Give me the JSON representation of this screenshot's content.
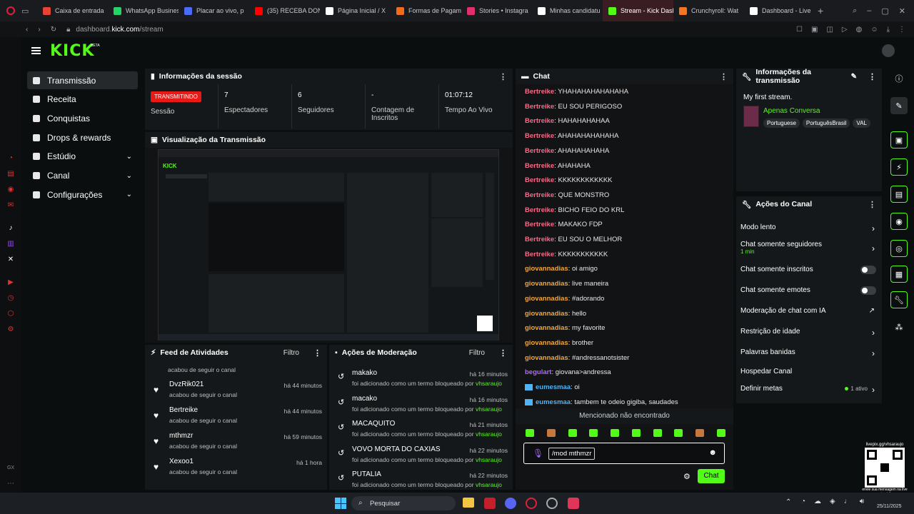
{
  "browser": {
    "tabs": [
      {
        "title": "Caixa de entrada",
        "color": "#ea4335"
      },
      {
        "title": "WhatsApp Business",
        "color": "#25d366"
      },
      {
        "title": "Placar ao vivo, p",
        "color": "#4a6cf7"
      },
      {
        "title": "(35) RECEBA DON",
        "color": "#ff0000"
      },
      {
        "title": "Página Inicial / X",
        "color": "#ffffff"
      },
      {
        "title": "Formas de Pagam",
        "color": "#f26b1d"
      },
      {
        "title": "Stories • Instagra",
        "color": "#e1306c"
      },
      {
        "title": "Minhas candidatu",
        "color": "#ffffff"
      },
      {
        "title": "Stream - Kick Dashb",
        "color": "#53fc18"
      },
      {
        "title": "Crunchyroll: Wat",
        "color": "#f47521"
      },
      {
        "title": "Dashboard - Live",
        "color": "#ffffff"
      }
    ],
    "url_prefix": "dashboard.",
    "url_host": "kick.com",
    "url_path": "/stream"
  },
  "brand": {
    "logo": "KICK",
    "beta": "BETA",
    "color": "#53fc18"
  },
  "nav": [
    {
      "label": "Transmissão",
      "active": true,
      "chevron": false
    },
    {
      "label": "Receita",
      "active": false,
      "chevron": false
    },
    {
      "label": "Conquistas",
      "active": false,
      "chevron": false
    },
    {
      "label": "Drops & rewards",
      "active": false,
      "chevron": false
    },
    {
      "label": "Estúdio",
      "active": false,
      "chevron": true
    },
    {
      "label": "Canal",
      "active": false,
      "chevron": true
    },
    {
      "label": "Configurações",
      "active": false,
      "chevron": true
    }
  ],
  "session": {
    "title": "Informações da sessão",
    "live_badge": "TRANSMITINDO",
    "session_label": "Sessão",
    "stats": [
      {
        "value": "7",
        "label": "Espectadores"
      },
      {
        "value": "6",
        "label": "Seguidores"
      },
      {
        "value": "-",
        "label": "Contagem de Inscritos"
      },
      {
        "value": "01:07:12",
        "label": "Tempo Ao Vivo"
      }
    ]
  },
  "preview": {
    "title": "Visualização da Transmissão"
  },
  "feed": {
    "title": "Feed de Atividades",
    "filter": "Filtro",
    "top_sub": "acabou de seguir o canal",
    "items": [
      {
        "name": "DvzRik021",
        "sub": "acabou de seguir o canal",
        "time": "há 44 minutos"
      },
      {
        "name": "Bertreike",
        "sub": "acabou de seguir o canal",
        "time": "há 44 minutos"
      },
      {
        "name": "mthmzr",
        "sub": "acabou de seguir o canal",
        "time": "há 59 minutos"
      },
      {
        "name": "Xexoo1",
        "sub": "acabou de seguir o canal",
        "time": "há 1 hora"
      }
    ]
  },
  "moderation": {
    "title": "Ações de Moderação",
    "filter": "Filtro",
    "sub_text": "foi adicionado como um termo bloqueado por",
    "by": "vhsaraujo",
    "items": [
      {
        "name": "makako",
        "time": "há 16 minutos"
      },
      {
        "name": "macako",
        "time": "há 16 minutos"
      },
      {
        "name": "MACAQUITO",
        "time": "há 21 minutos"
      },
      {
        "name": "VOVO MORTA DO CAXIAS",
        "time": "há 22 minutos"
      },
      {
        "name": "PUTALIA",
        "time": "há 22 minutos"
      }
    ]
  },
  "chat": {
    "title": "Chat",
    "messages": [
      {
        "user": "Bertreike",
        "text": ": YHAHAHAHAHAHAHA",
        "color": "#f56b8a"
      },
      {
        "user": "Bertreike",
        "text": ": EU SOU PERIGOSO",
        "color": "#f56b8a"
      },
      {
        "user": "Bertreike",
        "text": ": HAHAHAHAHAA",
        "color": "#f56b8a"
      },
      {
        "user": "Bertreike",
        "text": ": AHAHAHAHAHAHA",
        "color": "#f56b8a"
      },
      {
        "user": "Bertreike",
        "text": ": AHAHAHAHAHA",
        "color": "#f56b8a"
      },
      {
        "user": "Bertreike",
        "text": ": AHAHAHA",
        "color": "#f56b8a"
      },
      {
        "user": "Bertreike",
        "text": ": KKKKKKKKKKKK",
        "color": "#f56b8a"
      },
      {
        "user": "Bertreike",
        "text": ": QUE MONSTRO",
        "color": "#f56b8a"
      },
      {
        "user": "Bertreike",
        "text": ": BICHO FEIO DO KRL",
        "color": "#f56b8a"
      },
      {
        "user": "Bertreike",
        "text": ": MAKAKO FDP",
        "color": "#f56b8a"
      },
      {
        "user": "Bertreike",
        "text": ": EU SOU O MELHOR",
        "color": "#f56b8a"
      },
      {
        "user": "Bertreike",
        "text": ": KKKKKKKKKKK",
        "color": "#f56b8a"
      },
      {
        "user": "giovannadias",
        "text": ": oi amigo",
        "color": "#f2a73b"
      },
      {
        "user": "giovannadias",
        "text": ": live maneira",
        "color": "#f2a73b"
      },
      {
        "user": "giovannadias",
        "text": ": #adorando",
        "color": "#f2a73b"
      },
      {
        "user": "giovannadias",
        "text": ": hello",
        "color": "#f2a73b"
      },
      {
        "user": "giovannadias",
        "text": ": my favorite",
        "color": "#f2a73b"
      },
      {
        "user": "giovannadias",
        "text": ": brother",
        "color": "#f2a73b"
      },
      {
        "user": "giovannadias",
        "text": ": #andressanotsister",
        "color": "#f2a73b"
      },
      {
        "user": "begulart",
        "text": ": giovana>andressa",
        "color": "#b06bf7"
      },
      {
        "user": "eumesmaa",
        "text": ": oi",
        "color": "#4fb3f7"
      },
      {
        "user": "eumesmaa",
        "text": ": tambem te odeio gigiba, saudades",
        "color": "#4fb3f7"
      }
    ],
    "mention_notice": "Mencionado não encontrado",
    "input_value": "/mod mthmzr",
    "send_label": "Chat"
  },
  "stream_info": {
    "title": "Informações da transmissão",
    "stream_title": "My first stream.",
    "category": "Apenas Conversa",
    "tags": [
      "Portuguese",
      "PortuguêsBrasil",
      "VAL"
    ]
  },
  "channel_actions": {
    "title": "Ações do Canal",
    "items": [
      {
        "label": "Modo lento",
        "sub": "",
        "control": "chevron"
      },
      {
        "label": "Chat somente seguidores",
        "sub": "1 min",
        "control": "chevron"
      },
      {
        "label": "Chat somente inscritos",
        "sub": "",
        "control": "toggle"
      },
      {
        "label": "Chat somente emotes",
        "sub": "",
        "control": "toggle"
      },
      {
        "label": "Moderação de chat com IA",
        "sub": "",
        "control": "external"
      },
      {
        "label": "Restrição de idade",
        "sub": "",
        "control": "chevron"
      },
      {
        "label": "Palavras banidas",
        "sub": "",
        "control": "chevron"
      },
      {
        "label": "Hospedar Canal",
        "sub": "",
        "control": "none"
      },
      {
        "label": "Definir metas",
        "sub": "1 ativo",
        "control": "chevron"
      }
    ]
  },
  "qr": {
    "url_text": "livepix.gg/vhsaraujo",
    "caption": "envie sua mensagem na live via pix!"
  },
  "taskbar": {
    "search_placeholder": "Pesquisar",
    "date": "25/11/2025"
  }
}
